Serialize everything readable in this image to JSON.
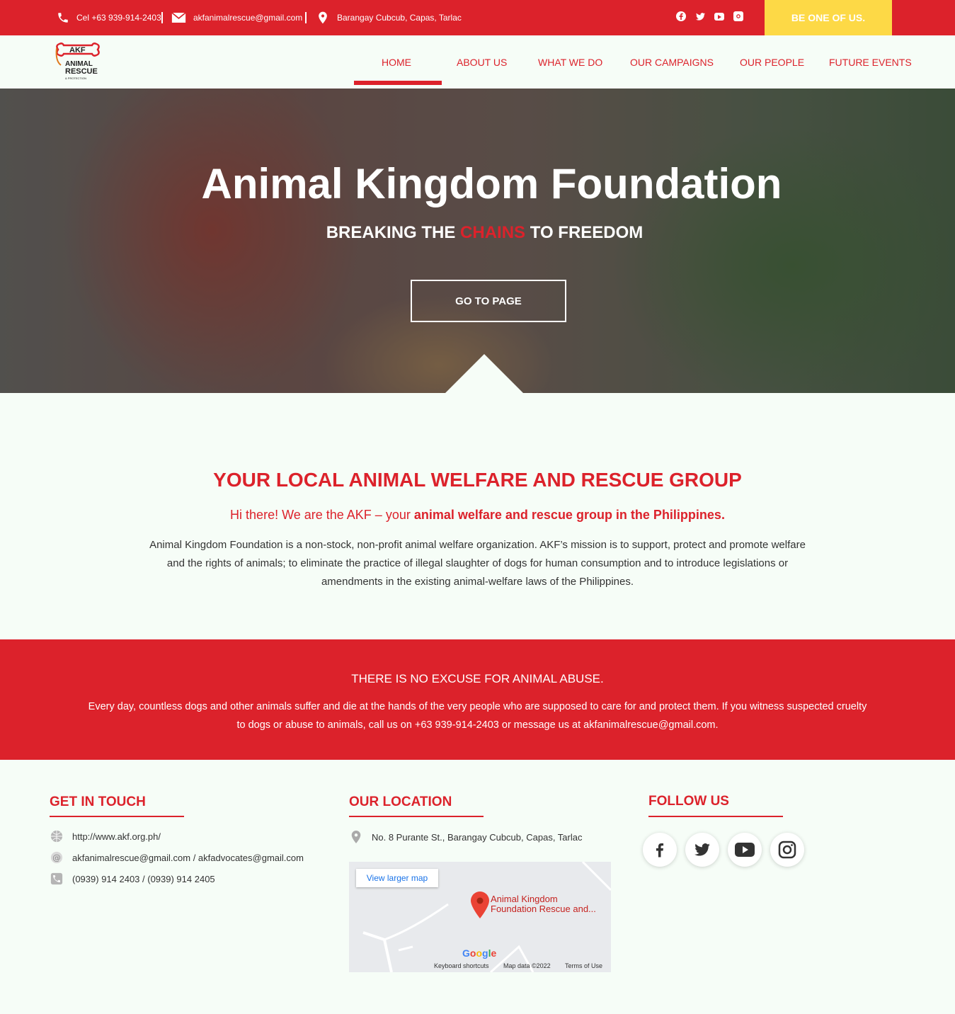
{
  "topbar": {
    "phone": "Cel +63 939-914-2403",
    "email": "akfanimalrescue@gmail.com",
    "address": "Barangay Cubcub, Capas, Tarlac",
    "cta": "BE ONE OF US.",
    "social_icons": [
      "facebook-icon",
      "twitter-icon",
      "youtube-icon",
      "instagram-icon"
    ]
  },
  "logo": {
    "line1": "AKF",
    "line2": "ANIMAL",
    "line3": "RESCUE",
    "line4": "& PROTECTION"
  },
  "nav": {
    "active": "HOME",
    "items": [
      "HOME",
      "ABOUT US",
      "WHAT WE DO",
      "OUR CAMPAIGNS",
      "OUR PEOPLE",
      "FUTURE EVENTS"
    ]
  },
  "hero": {
    "title": "Animal Kingdom Foundation",
    "subtitle_pre": "BREAKING THE ",
    "subtitle_accent": "CHAINS",
    "subtitle_post": " TO FREEDOM",
    "button": "GO TO PAGE"
  },
  "intro": {
    "title": "YOUR LOCAL ANIMAL WELFARE AND RESCUE GROUP",
    "sub_pre": "Hi there! We are the AKF – your ",
    "sub_bold": "animal welfare and rescue group in the Philippines.",
    "body": "Animal Kingdom Foundation is a non-stock, non-profit animal welfare organization. AKF’s mission is to support, protect and promote welfare and the rights of animals; to eliminate the practice of illegal slaughter of dogs for human consumption and to introduce legislations or amendments in the existing animal-welfare laws of the Philippines."
  },
  "band": {
    "title": "THERE IS NO EXCUSE FOR ANIMAL ABUSE.",
    "body": "Every day, countless dogs and other animals suffer and die at the hands of the very people who are supposed to care for and protect them. If you witness suspected cruelty to dogs or abuse to animals, call us on +63 939-914-2403 or message us at akfanimalrescue@gmail.com."
  },
  "footer": {
    "touch_title": "GET IN TOUCH",
    "website": "http://www.akf.org.ph/",
    "emails": "akfanimalrescue@gmail.com / akfadvocates@gmail.com",
    "phones": "(0939) 914 2403 / (0939) 914 2405",
    "location_title": "OUR LOCATION",
    "location": "No. 8 Purante St., Barangay Cubcub, Capas, Tarlac",
    "follow_title": "FOLLOW US"
  },
  "map": {
    "view_larger": "View larger map",
    "place_line1": "Animal Kingdom",
    "place_line2": "Foundation Rescue and...",
    "shortcuts": "Keyboard shortcuts",
    "map_data": "Map data ©2022",
    "terms": "Terms of Use"
  },
  "colors": {
    "brand_red": "#dc222b",
    "cta_yellow": "#fdd946",
    "page_bg": "#f6fdf7"
  }
}
